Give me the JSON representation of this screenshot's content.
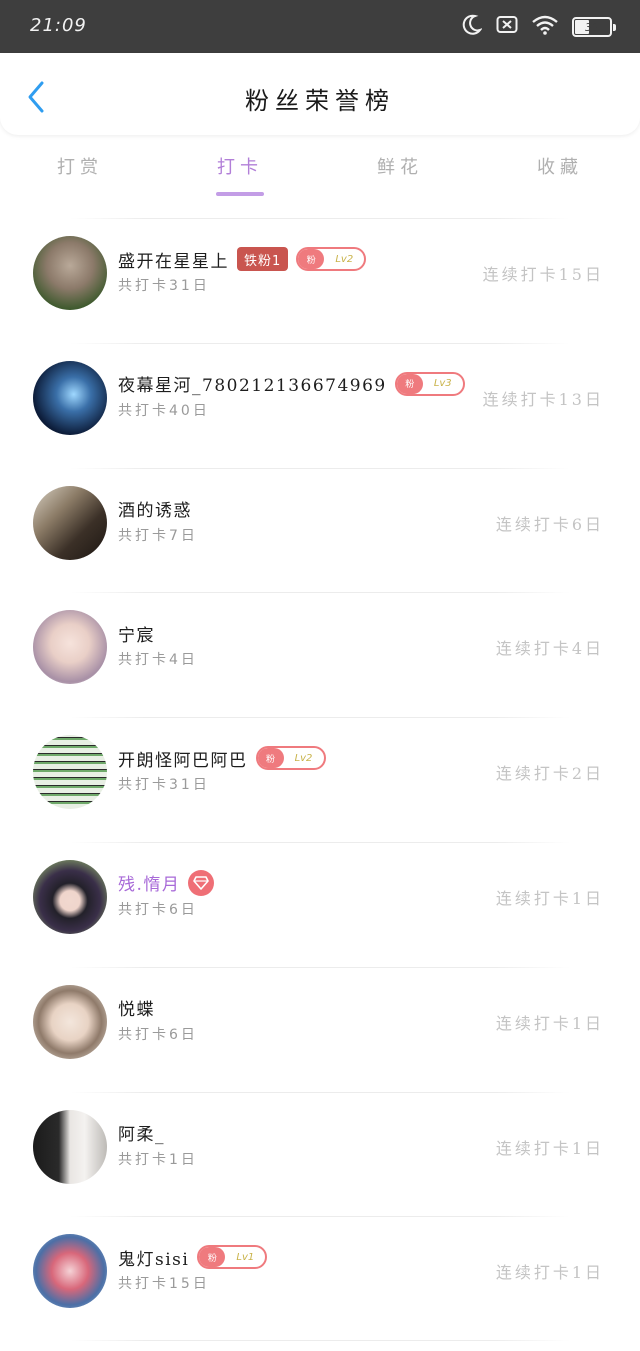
{
  "status_bar": {
    "time": "21:09",
    "battery": "39",
    "icons": [
      "moon-icon",
      "notification-off-icon",
      "wifi-icon",
      "battery-icon"
    ]
  },
  "header": {
    "title": "粉丝荣誉榜",
    "back_icon": "chevron-left-icon"
  },
  "tabs": [
    {
      "label": "打赏",
      "active": false
    },
    {
      "label": "打卡",
      "active": true
    },
    {
      "label": "鲜花",
      "active": false
    },
    {
      "label": "收藏",
      "active": false
    }
  ],
  "colors": {
    "accent": "#b27fd8",
    "back_arrow": "#2f9df0",
    "fan_badge": "#c9554f",
    "level_badge": "#ef7a7e"
  },
  "rows": [
    {
      "name": "盛开在星星上",
      "fan_badge": "铁粉1",
      "level_badge": {
        "left": "粉",
        "right": "Lv2"
      },
      "total": "共打卡31日",
      "streak": "连续打卡15日"
    },
    {
      "name": "夜幕星河_780212136674969",
      "level_badge": {
        "left": "粉",
        "right": "Lv3"
      },
      "total": "共打卡40日",
      "streak": "连续打卡13日"
    },
    {
      "name": "酒的诱惑",
      "total": "共打卡7日",
      "streak": "连续打卡6日"
    },
    {
      "name": "宁宸",
      "total": "共打卡4日",
      "streak": "连续打卡4日"
    },
    {
      "name": "开朗怪阿巴阿巴",
      "level_badge": {
        "left": "粉",
        "right": "Lv2"
      },
      "total": "共打卡31日",
      "streak": "连续打卡2日"
    },
    {
      "name": "残.惰月",
      "vip": true,
      "gem_icon": "diamond-icon",
      "total": "共打卡6日",
      "streak": "连续打卡1日"
    },
    {
      "name": "悦蝶",
      "total": "共打卡6日",
      "streak": "连续打卡1日"
    },
    {
      "name": "阿柔_",
      "total": "共打卡1日",
      "streak": "连续打卡1日"
    },
    {
      "name": "鬼灯sisi",
      "level_badge": {
        "left": "粉",
        "right": "Lv1"
      },
      "total": "共打卡15日",
      "streak": "连续打卡1日"
    }
  ]
}
